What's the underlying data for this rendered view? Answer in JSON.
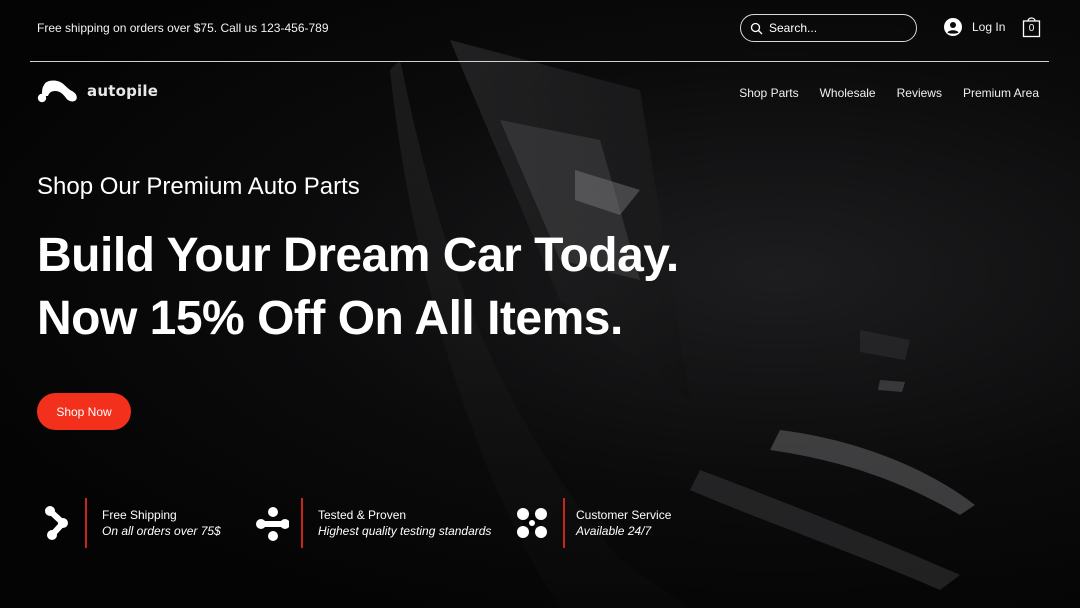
{
  "topbar": {
    "announcement": "Free shipping on orders over $75. Call us 123-456-789",
    "search": {
      "placeholder": "Search..."
    },
    "login_label": "Log In",
    "cart_count": "0"
  },
  "brand": {
    "name": "autopile"
  },
  "nav": {
    "items": [
      {
        "label": "Shop Parts"
      },
      {
        "label": "Wholesale"
      },
      {
        "label": "Reviews"
      },
      {
        "label": "Premium Area"
      }
    ]
  },
  "hero": {
    "eyebrow": "Shop Our Premium Auto Parts",
    "headline_line1": "Build Your Dream Car Today.",
    "headline_line2": "Now 15% Off On All Items.",
    "cta_label": "Shop Now"
  },
  "features": [
    {
      "icon": "shipping-icon",
      "title": "Free Shipping",
      "subtitle": "On all orders over 75$"
    },
    {
      "icon": "tested-icon",
      "title": "Tested & Proven",
      "subtitle": "Highest quality testing standards"
    },
    {
      "icon": "service-icon",
      "title": "Customer Service",
      "subtitle": "Available 24/7"
    }
  ],
  "colors": {
    "accent": "#f2301c",
    "divider_red": "#c8261a",
    "background": "#050505",
    "text": "#ffffff"
  }
}
